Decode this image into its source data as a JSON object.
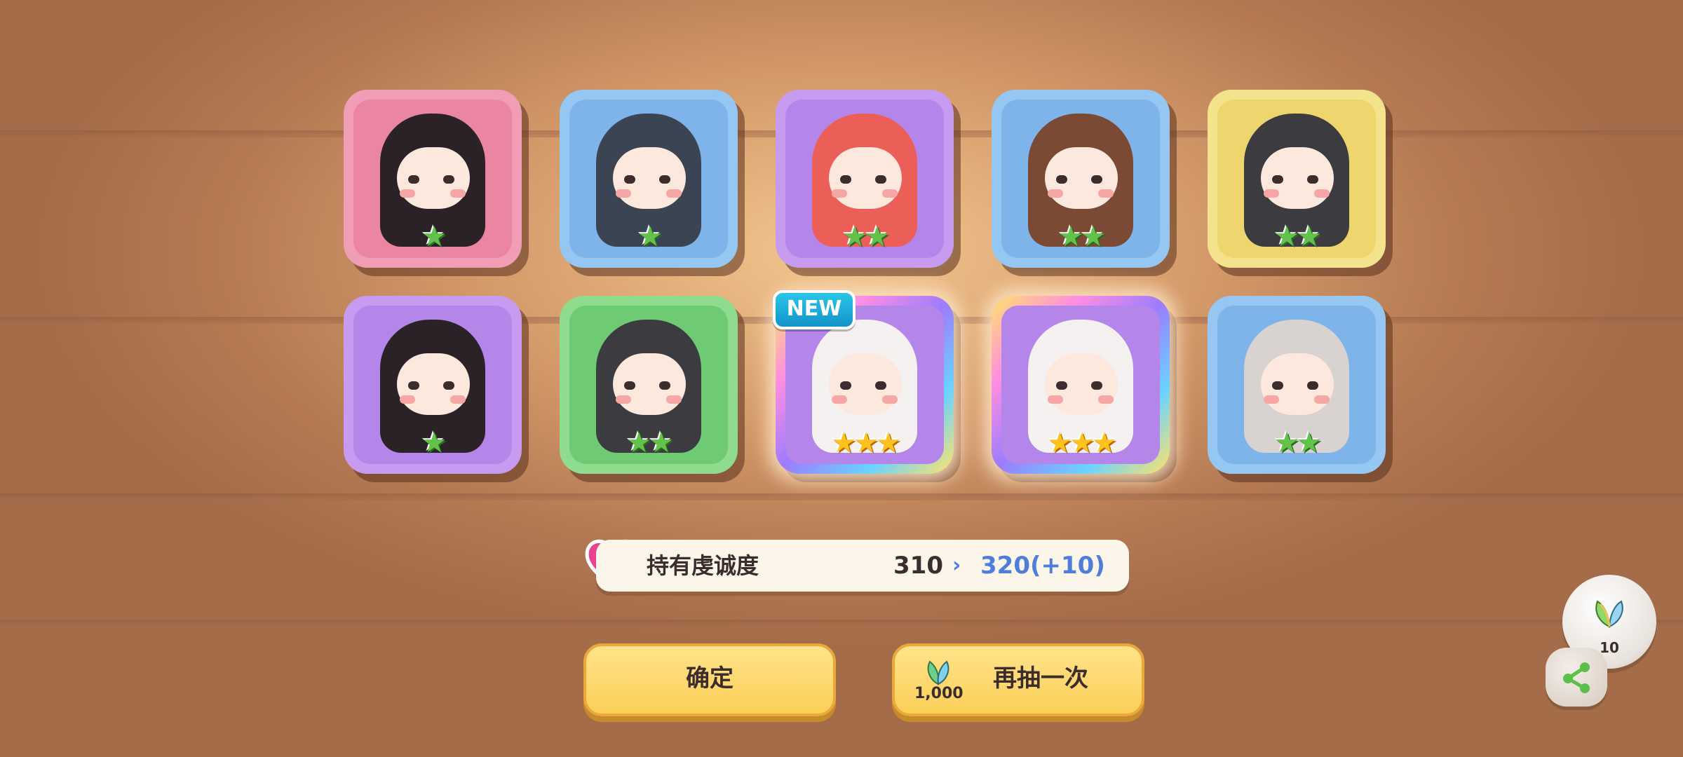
{
  "cards": [
    {
      "bg": "#f19db5",
      "inner": "#eb86a2",
      "hair": "#2a2227",
      "stars": "★",
      "star_type": "green",
      "label": "1-star character"
    },
    {
      "bg": "#96c7f2",
      "inner": "#7fb4ea",
      "hair": "#3b4452",
      "stars": "★",
      "star_type": "green",
      "label": "1-star character"
    },
    {
      "bg": "#c79cf0",
      "inner": "#b586ea",
      "hair": "#ec5f58",
      "stars": "★★",
      "star_type": "green",
      "label": "2-star character"
    },
    {
      "bg": "#96c7f2",
      "inner": "#7fb4ea",
      "hair": "#7a4a34",
      "stars": "★★",
      "star_type": "green",
      "label": "2-star character"
    },
    {
      "bg": "#f4e38d",
      "inner": "#eed56d",
      "hair": "#3c3b3f",
      "stars": "★★",
      "star_type": "green",
      "label": "2-star character"
    },
    {
      "bg": "#c79cf0",
      "inner": "#b586ea",
      "hair": "#2a2227",
      "stars": "★",
      "star_type": "green",
      "label": "1-star character"
    },
    {
      "bg": "#8fdc8e",
      "inner": "#6fcb73",
      "hair": "#3c3b3f",
      "stars": "★★",
      "star_type": "green",
      "label": "2-star character"
    },
    {
      "bg": "#c79cf0",
      "inner": "#b586ea",
      "hair": "#f4f1f0",
      "stars": "★★★",
      "star_type": "gold",
      "label": "3-star character",
      "new": true,
      "glow": true
    },
    {
      "bg": "#c79cf0",
      "inner": "#b586ea",
      "hair": "#f4f1f0",
      "stars": "★★★",
      "star_type": "gold",
      "label": "3-star character",
      "glow": true
    },
    {
      "bg": "#96c7f2",
      "inner": "#7fb4ea",
      "hair": "#d8d2d0",
      "stars": "★★",
      "star_type": "green",
      "label": "2-star character"
    }
  ],
  "new_badge": "NEW",
  "loyalty": {
    "label": "持有虔诚度",
    "old_value": "310",
    "arrow": "›",
    "new_value": "320(+10)"
  },
  "buttons": {
    "confirm": "确定",
    "draw_again": "再抽一次",
    "draw_cost": "1,000"
  },
  "side": {
    "orb_count": "10"
  },
  "colors": {
    "accent_blue": "#4f7ddb",
    "button_yellow": "#fccf58",
    "text_dark": "#3b2d2d"
  }
}
